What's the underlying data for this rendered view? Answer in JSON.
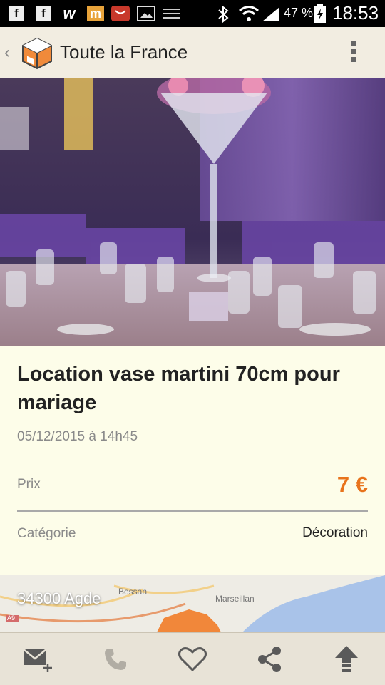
{
  "status_bar": {
    "battery": "47 %",
    "time": "18:53",
    "app_icons": [
      "facebook-icon",
      "facebook-icon",
      "w-icon",
      "m-icon",
      "shop-icon",
      "gallery-icon",
      "menu-icon"
    ],
    "right_icons": [
      "bluetooth-icon",
      "wifi-icon",
      "signal-icon",
      "battery-icon"
    ]
  },
  "app_bar": {
    "title": "Toute la France",
    "back_icon": "chevron-left-icon",
    "logo_icon": "box-logo-icon",
    "menu_icon": "overflow-menu-icon"
  },
  "listing": {
    "photo": "martini-vase-table-photo",
    "title": "Location vase martini 70cm pour mariage",
    "date": "05/12/2015 à 14h45",
    "price_label": "Prix",
    "price": "7 €",
    "category_label": "Catégorie",
    "category": "Décoration"
  },
  "map": {
    "location": "34300 Agde",
    "labels": [
      "Bessan",
      "Marseillan",
      "A9"
    ]
  },
  "bottom_bar": [
    {
      "name": "message-button",
      "icon": "mail-plus-icon"
    },
    {
      "name": "call-button",
      "icon": "phone-icon"
    },
    {
      "name": "favorite-button",
      "icon": "heart-icon"
    },
    {
      "name": "share-button",
      "icon": "share-icon"
    },
    {
      "name": "boost-button",
      "icon": "arrow-up-icon"
    }
  ],
  "colors": {
    "accent": "#e8731c",
    "background": "#fdfde9",
    "appbar": "#f2ede1"
  }
}
